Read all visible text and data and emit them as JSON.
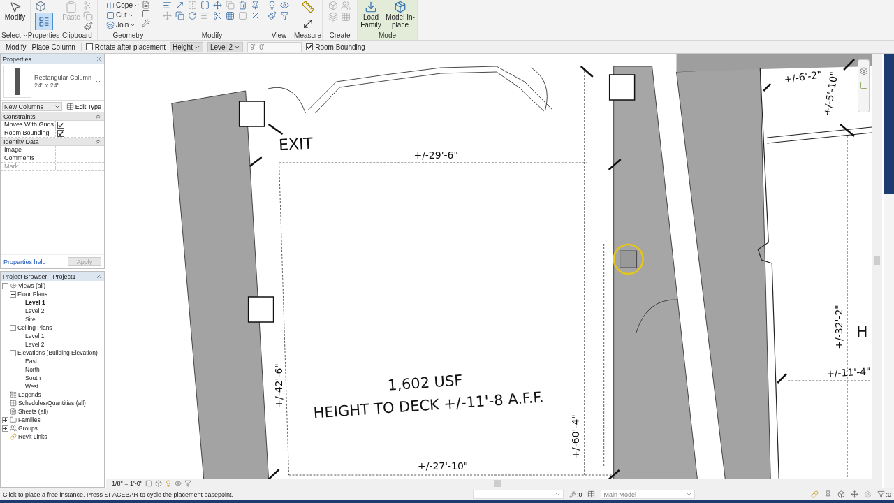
{
  "ribbon": {
    "panels": [
      {
        "label": "Select",
        "dropdown": true
      },
      {
        "label": "Properties",
        "dropdown": false
      },
      {
        "label": "Clipboard",
        "dropdown": false
      },
      {
        "label": "Geometry",
        "dropdown": false
      },
      {
        "label": "Modify",
        "dropdown": false
      },
      {
        "label": "View",
        "dropdown": false
      },
      {
        "label": "Measure",
        "dropdown": false
      },
      {
        "label": "Create",
        "dropdown": false
      },
      {
        "label": "Mode",
        "dropdown": false
      }
    ],
    "tools": [
      {
        "label": "Modify",
        "disabled": false
      },
      {
        "label": "Paste",
        "disabled": true
      },
      {
        "label": "Cope",
        "disabled": false
      },
      {
        "label": "Cut",
        "disabled": false
      },
      {
        "label": "Join",
        "disabled": false
      },
      {
        "label": "Load Family",
        "disabled": false
      },
      {
        "label": "Model In-place",
        "disabled": false
      }
    ],
    "properties_on": true
  },
  "options": {
    "context": "Modify | Place Column",
    "rotate": {
      "label": "Rotate after placement",
      "checked": false
    },
    "depth_mode": "Height",
    "level": "Level 2",
    "offset": "9'  0\"",
    "room_bounding": {
      "label": "Room Bounding",
      "checked": true
    }
  },
  "properties": {
    "title": "Properties",
    "type_name": "Rectangular Column",
    "type_size": "24\" x 24\"",
    "instance_filter": "New Columns",
    "edit_type": "Edit Type",
    "groups": [
      {
        "label": "Constraints",
        "expanded": true,
        "rows": [
          {
            "label": "Moves With Grids",
            "kind": "checkbox",
            "checked": true,
            "disabled": false
          },
          {
            "label": "Room Bounding",
            "kind": "checkbox",
            "checked": true,
            "disabled": false
          }
        ]
      },
      {
        "label": "Identity Data",
        "expanded": true,
        "rows": [
          {
            "label": "Image",
            "kind": "text",
            "disabled": false
          },
          {
            "label": "Comments",
            "kind": "text",
            "disabled": false
          },
          {
            "label": "Mark",
            "kind": "text",
            "disabled": true
          }
        ]
      }
    ],
    "help_link": "Properties help",
    "apply": {
      "label": "Apply",
      "disabled": true
    }
  },
  "browser": {
    "title": "Project Browser - Project1",
    "tree": [
      {
        "label": "Views (all)",
        "expanded": true,
        "children": [
          {
            "label": "Floor Plans",
            "expanded": true,
            "children": [
              {
                "label": "Level 1",
                "selected": true
              },
              {
                "label": "Level 2",
                "selected": false
              },
              {
                "label": "Site",
                "selected": false
              }
            ]
          },
          {
            "label": "Ceiling Plans",
            "expanded": true,
            "children": [
              {
                "label": "Level 1",
                "selected": false
              },
              {
                "label": "Level 2",
                "selected": false
              }
            ]
          },
          {
            "label": "Elevations (Building Elevation)",
            "expanded": true,
            "children": [
              {
                "label": "East",
                "selected": false
              },
              {
                "label": "North",
                "selected": false
              },
              {
                "label": "South",
                "selected": false
              },
              {
                "label": "West",
                "selected": false
              }
            ]
          }
        ]
      },
      {
        "label": "Legends",
        "selected": false
      },
      {
        "label": "Schedules/Quantities (all)",
        "selected": false
      },
      {
        "label": "Sheets (all)",
        "selected": false
      },
      {
        "label": "Families",
        "expanded": false
      },
      {
        "label": "Groups",
        "expanded": false
      },
      {
        "label": "Revit Links",
        "selected": false
      }
    ]
  },
  "drawing": {
    "labels": [
      {
        "text": "EXIT",
        "kind": "note"
      },
      {
        "text": "+/-29'-6\"",
        "kind": "dimension"
      },
      {
        "text": "+/-42'-6\"",
        "kind": "dimension"
      },
      {
        "text": "1,602 USF",
        "kind": "room"
      },
      {
        "text": "HEIGHT TO DECK +/-11'-8 A.F.F.",
        "kind": "room"
      },
      {
        "text": "+/-60'-4\"",
        "kind": "dimension"
      },
      {
        "text": "+/-27'-10\"",
        "kind": "dimension"
      },
      {
        "text": "+/-6'-2\"",
        "kind": "dimension"
      },
      {
        "text": "+/-5'-10\"",
        "kind": "dimension"
      },
      {
        "text": "+/-32'-2\"",
        "kind": "dimension"
      },
      {
        "text": "+/-11'-4\"",
        "kind": "dimension"
      },
      {
        "text": "H",
        "kind": "note"
      }
    ]
  },
  "view_bar": {
    "scale": "1/8\" = 1'-0\""
  },
  "status": {
    "prompt": "Click to place a free instance. Press SPACEBAR to cycle the placement basepoint.",
    "selection_count": ":0",
    "workset": "Main Model",
    "filter_count": ":0"
  }
}
